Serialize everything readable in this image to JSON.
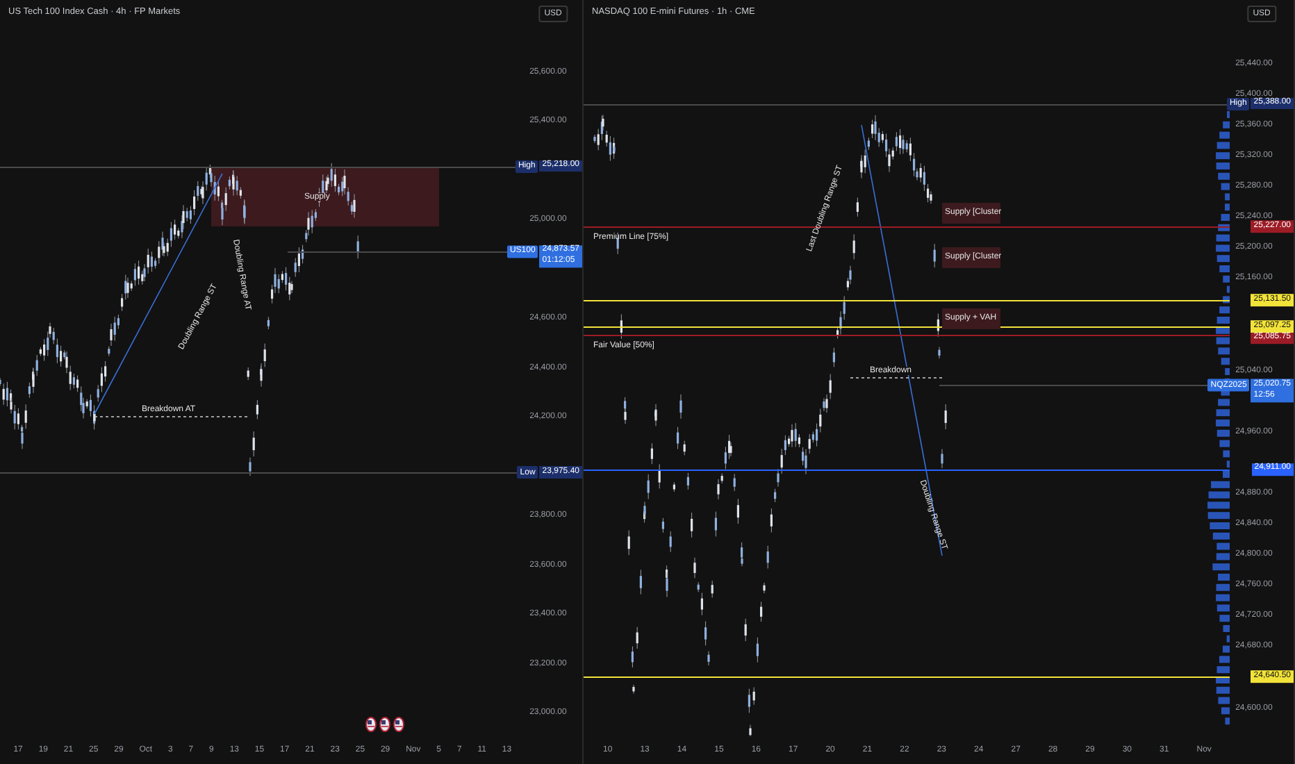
{
  "panes": [
    {
      "title": "US Tech 100 Index Cash · 4h · FP Markets",
      "currency": "USD",
      "price_axis": [
        "25,600.00",
        "25,400.00",
        "25,000.00",
        "24,600.00",
        "24,400.00",
        "24,200.00",
        "23,800.00",
        "23,600.00",
        "23,400.00",
        "23,200.00",
        "23,000.00"
      ],
      "levels": [
        {
          "label": "High",
          "price": "25,218.00",
          "color": "#1c2f6b"
        },
        {
          "label": "Low",
          "price": "23,975.40",
          "color": "#1c2f6b"
        }
      ],
      "current": {
        "symbol": "US100",
        "price": "24,873.57",
        "countdown": "01:12:05"
      },
      "annotations": [
        {
          "kind": "label",
          "text": "Supply"
        },
        {
          "kind": "dashed",
          "text": "Breakdown AT"
        },
        {
          "kind": "rotated",
          "text": "Doubling Range ST"
        },
        {
          "kind": "rotated",
          "text": "Doubling Range AT"
        }
      ],
      "time_axis": [
        "17",
        "19",
        "21",
        "25",
        "29",
        "Oct",
        "3",
        "7",
        "9",
        "13",
        "15",
        "17",
        "21",
        "23",
        "25",
        "29",
        "Nov",
        "5",
        "7",
        "11",
        "13"
      ]
    },
    {
      "title": "NASDAQ 100 E-mini Futures · 1h · CME",
      "currency": "USD",
      "price_axis": [
        "25,440.00",
        "25,400.00",
        "25,360.00",
        "25,320.00",
        "25,280.00",
        "25,240.00",
        "25,200.00",
        "25,160.00",
        "25,040.00",
        "24,960.00",
        "24,880.00",
        "24,840.00",
        "24,800.00",
        "24,760.00",
        "24,720.00",
        "24,680.00",
        "24,600.00"
      ],
      "levels": [
        {
          "label": "High",
          "price": "25,388.00",
          "color": "#1c2f6b"
        },
        {
          "price": "25,227.00",
          "color": "#9c1c26"
        },
        {
          "price": "25,131.50",
          "color": "#f2e33a"
        },
        {
          "price": "25,097.25",
          "color": "#f2e33a"
        },
        {
          "price": "25,085.75",
          "color": "#9c1c26"
        },
        {
          "price": "24,911.00",
          "color": "#2962ff"
        },
        {
          "price": "24,640.50",
          "color": "#f2e33a"
        }
      ],
      "current": {
        "symbol": "NQZ2025",
        "price": "25,020.75",
        "countdown": "12:56"
      },
      "annotations": [
        {
          "kind": "label",
          "text": "Premium Line [75%]"
        },
        {
          "kind": "label",
          "text": "Fair Value [50%]"
        },
        {
          "kind": "zone",
          "text": "Supply [Cluster"
        },
        {
          "kind": "zone",
          "text": "Supply [Cluster"
        },
        {
          "kind": "zone",
          "text": "Supply + VAH"
        },
        {
          "kind": "dashed",
          "text": "Breakdown"
        },
        {
          "kind": "rotated",
          "text": "Last Doubling Range ST"
        },
        {
          "kind": "rotated",
          "text": "Doubling Range ST"
        }
      ],
      "time_axis": [
        "10",
        "13",
        "14",
        "15",
        "16",
        "17",
        "20",
        "21",
        "22",
        "23",
        "24",
        "27",
        "28",
        "29",
        "30",
        "31",
        "Nov"
      ]
    }
  ]
}
